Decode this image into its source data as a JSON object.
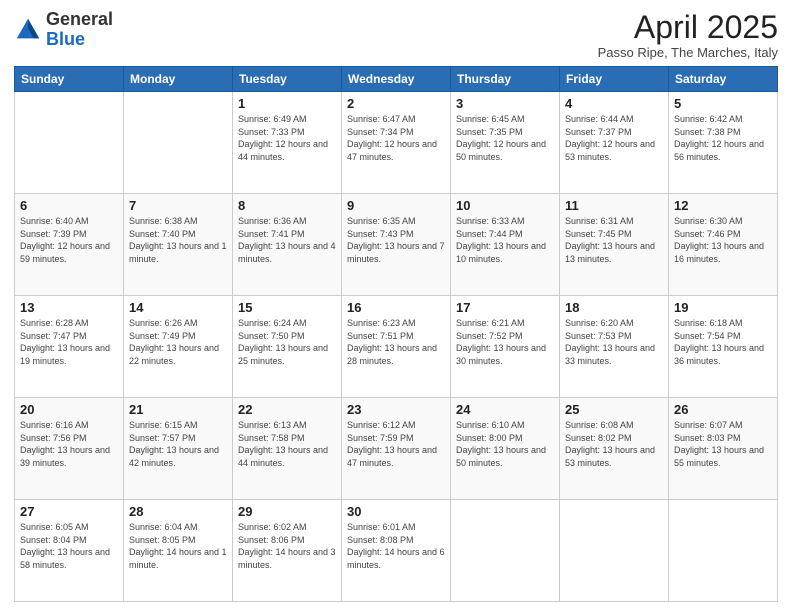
{
  "logo": {
    "general": "General",
    "blue": "Blue"
  },
  "header": {
    "month": "April 2025",
    "location": "Passo Ripe, The Marches, Italy"
  },
  "weekdays": [
    "Sunday",
    "Monday",
    "Tuesday",
    "Wednesday",
    "Thursday",
    "Friday",
    "Saturday"
  ],
  "weeks": [
    [
      {
        "day": "",
        "info": ""
      },
      {
        "day": "",
        "info": ""
      },
      {
        "day": "1",
        "info": "Sunrise: 6:49 AM\nSunset: 7:33 PM\nDaylight: 12 hours and 44 minutes."
      },
      {
        "day": "2",
        "info": "Sunrise: 6:47 AM\nSunset: 7:34 PM\nDaylight: 12 hours and 47 minutes."
      },
      {
        "day": "3",
        "info": "Sunrise: 6:45 AM\nSunset: 7:35 PM\nDaylight: 12 hours and 50 minutes."
      },
      {
        "day": "4",
        "info": "Sunrise: 6:44 AM\nSunset: 7:37 PM\nDaylight: 12 hours and 53 minutes."
      },
      {
        "day": "5",
        "info": "Sunrise: 6:42 AM\nSunset: 7:38 PM\nDaylight: 12 hours and 56 minutes."
      }
    ],
    [
      {
        "day": "6",
        "info": "Sunrise: 6:40 AM\nSunset: 7:39 PM\nDaylight: 12 hours and 59 minutes."
      },
      {
        "day": "7",
        "info": "Sunrise: 6:38 AM\nSunset: 7:40 PM\nDaylight: 13 hours and 1 minute."
      },
      {
        "day": "8",
        "info": "Sunrise: 6:36 AM\nSunset: 7:41 PM\nDaylight: 13 hours and 4 minutes."
      },
      {
        "day": "9",
        "info": "Sunrise: 6:35 AM\nSunset: 7:43 PM\nDaylight: 13 hours and 7 minutes."
      },
      {
        "day": "10",
        "info": "Sunrise: 6:33 AM\nSunset: 7:44 PM\nDaylight: 13 hours and 10 minutes."
      },
      {
        "day": "11",
        "info": "Sunrise: 6:31 AM\nSunset: 7:45 PM\nDaylight: 13 hours and 13 minutes."
      },
      {
        "day": "12",
        "info": "Sunrise: 6:30 AM\nSunset: 7:46 PM\nDaylight: 13 hours and 16 minutes."
      }
    ],
    [
      {
        "day": "13",
        "info": "Sunrise: 6:28 AM\nSunset: 7:47 PM\nDaylight: 13 hours and 19 minutes."
      },
      {
        "day": "14",
        "info": "Sunrise: 6:26 AM\nSunset: 7:49 PM\nDaylight: 13 hours and 22 minutes."
      },
      {
        "day": "15",
        "info": "Sunrise: 6:24 AM\nSunset: 7:50 PM\nDaylight: 13 hours and 25 minutes."
      },
      {
        "day": "16",
        "info": "Sunrise: 6:23 AM\nSunset: 7:51 PM\nDaylight: 13 hours and 28 minutes."
      },
      {
        "day": "17",
        "info": "Sunrise: 6:21 AM\nSunset: 7:52 PM\nDaylight: 13 hours and 30 minutes."
      },
      {
        "day": "18",
        "info": "Sunrise: 6:20 AM\nSunset: 7:53 PM\nDaylight: 13 hours and 33 minutes."
      },
      {
        "day": "19",
        "info": "Sunrise: 6:18 AM\nSunset: 7:54 PM\nDaylight: 13 hours and 36 minutes."
      }
    ],
    [
      {
        "day": "20",
        "info": "Sunrise: 6:16 AM\nSunset: 7:56 PM\nDaylight: 13 hours and 39 minutes."
      },
      {
        "day": "21",
        "info": "Sunrise: 6:15 AM\nSunset: 7:57 PM\nDaylight: 13 hours and 42 minutes."
      },
      {
        "day": "22",
        "info": "Sunrise: 6:13 AM\nSunset: 7:58 PM\nDaylight: 13 hours and 44 minutes."
      },
      {
        "day": "23",
        "info": "Sunrise: 6:12 AM\nSunset: 7:59 PM\nDaylight: 13 hours and 47 minutes."
      },
      {
        "day": "24",
        "info": "Sunrise: 6:10 AM\nSunset: 8:00 PM\nDaylight: 13 hours and 50 minutes."
      },
      {
        "day": "25",
        "info": "Sunrise: 6:08 AM\nSunset: 8:02 PM\nDaylight: 13 hours and 53 minutes."
      },
      {
        "day": "26",
        "info": "Sunrise: 6:07 AM\nSunset: 8:03 PM\nDaylight: 13 hours and 55 minutes."
      }
    ],
    [
      {
        "day": "27",
        "info": "Sunrise: 6:05 AM\nSunset: 8:04 PM\nDaylight: 13 hours and 58 minutes."
      },
      {
        "day": "28",
        "info": "Sunrise: 6:04 AM\nSunset: 8:05 PM\nDaylight: 14 hours and 1 minute."
      },
      {
        "day": "29",
        "info": "Sunrise: 6:02 AM\nSunset: 8:06 PM\nDaylight: 14 hours and 3 minutes."
      },
      {
        "day": "30",
        "info": "Sunrise: 6:01 AM\nSunset: 8:08 PM\nDaylight: 14 hours and 6 minutes."
      },
      {
        "day": "",
        "info": ""
      },
      {
        "day": "",
        "info": ""
      },
      {
        "day": "",
        "info": ""
      }
    ]
  ]
}
